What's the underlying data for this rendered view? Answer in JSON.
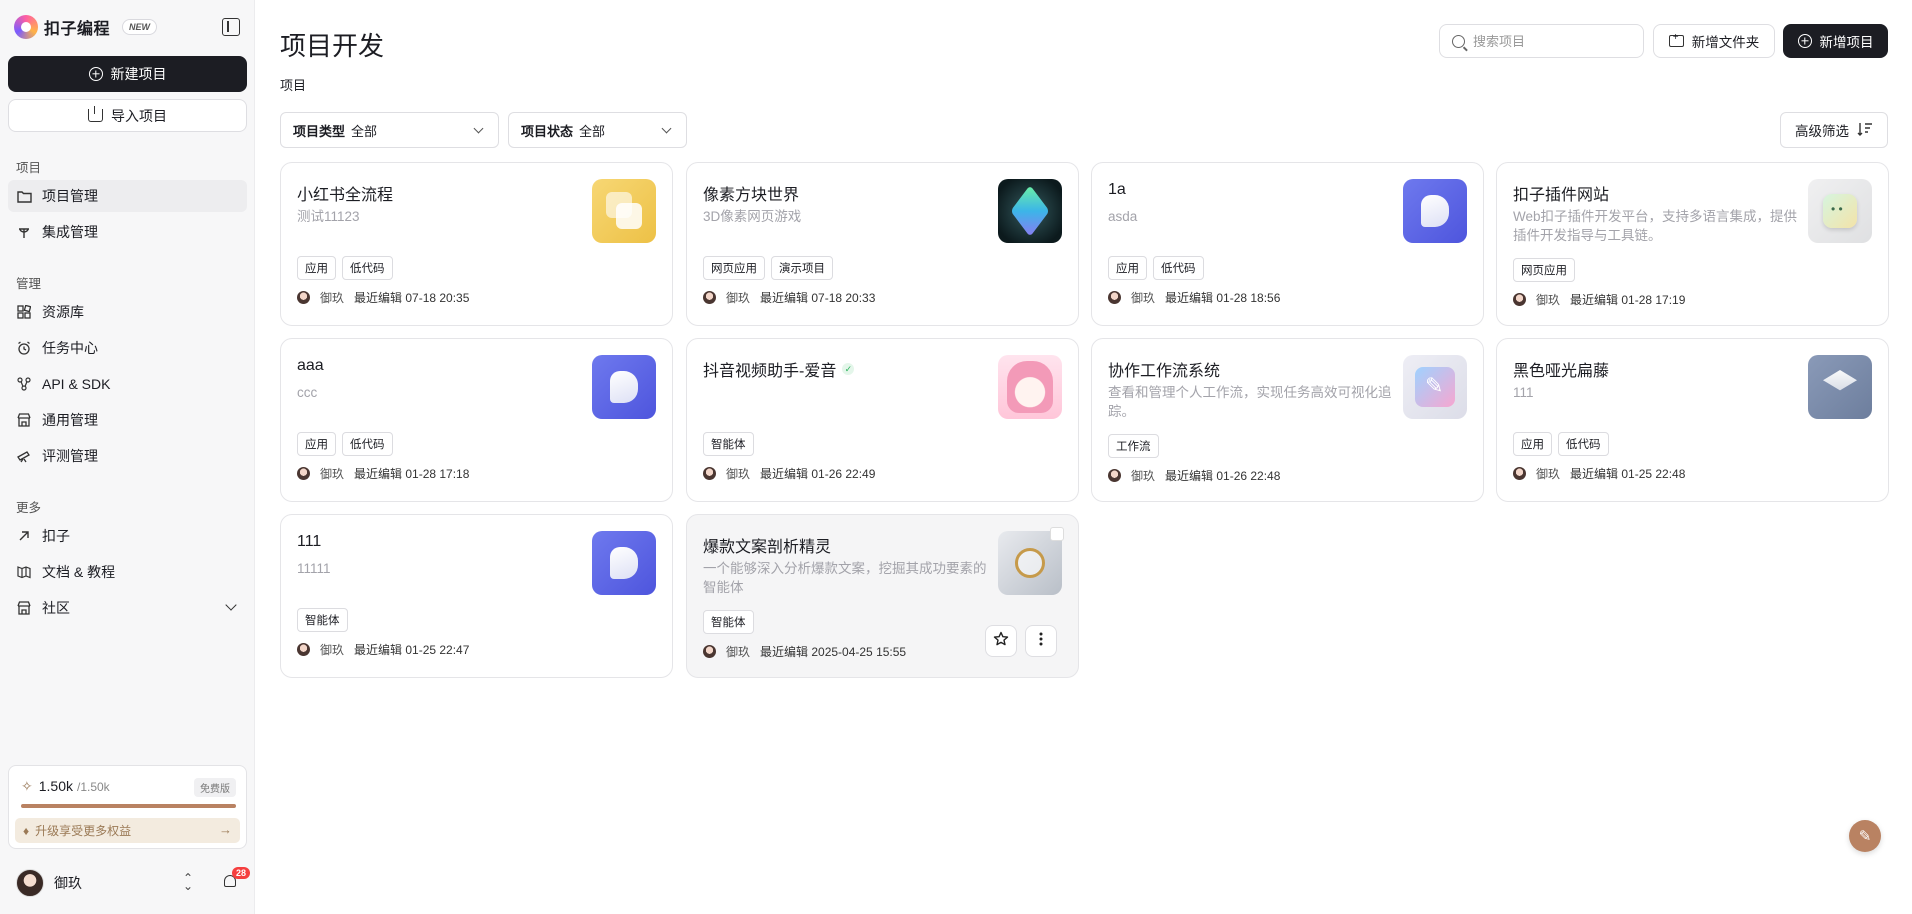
{
  "brand": {
    "name": "扣子编程",
    "badge": "NEW"
  },
  "sidebar": {
    "new_project": "新建项目",
    "import_project": "导入项目",
    "sections": {
      "project": "项目",
      "manage": "管理",
      "more": "更多"
    },
    "items": {
      "project_manage": "项目管理",
      "integration": "集成管理",
      "resources": "资源库",
      "tasks": "任务中心",
      "api_sdk": "API & SDK",
      "general": "通用管理",
      "evaluation": "评测管理",
      "kouzi": "扣子",
      "docs": "文档 & 教程",
      "community": "社区"
    },
    "quota": {
      "used": "1.50k",
      "max": "/1.50k",
      "tier": "免费版",
      "fill_percent": 100,
      "upgrade": "升级享受更多权益"
    },
    "user": {
      "name": "御玖",
      "notifications": "28"
    }
  },
  "header": {
    "title": "项目开发",
    "subtitle": "项目",
    "search_placeholder": "搜索项目",
    "new_folder": "新增文件夹",
    "new_project": "新增项目"
  },
  "filters": {
    "type_label": "项目类型",
    "type_value": "全部",
    "status_label": "项目状态",
    "status_value": "全部",
    "advanced": "高级筛选"
  },
  "projects": [
    {
      "title": "小红书全流程",
      "desc": "测试11123",
      "tags": [
        "应用",
        "低代码"
      ],
      "author": "御玖",
      "edited": "最近编辑 07-18 20:35",
      "thumb": "yellow-squares"
    },
    {
      "title": "像素方块世界",
      "desc": "3D像素网页游戏",
      "tags": [
        "网页应用",
        "演示项目"
      ],
      "author": "御玖",
      "edited": "最近编辑 07-18 20:33",
      "thumb": "pixel-cube"
    },
    {
      "title": "1a",
      "desc": "asda",
      "tags": [
        "应用",
        "低代码"
      ],
      "author": "御玖",
      "edited": "最近编辑 01-28 18:56",
      "thumb": "b-logo"
    },
    {
      "title": "扣子插件网站",
      "desc": "Web扣子插件开发平台，支持多语言集成，提供插件开发指导与工具链。",
      "tags": [
        "网页应用"
      ],
      "author": "御玖",
      "edited": "最近编辑 01-28 17:19",
      "thumb": "plugin"
    },
    {
      "title": "aaa",
      "desc": "ccc",
      "tags": [
        "应用",
        "低代码"
      ],
      "author": "御玖",
      "edited": "最近编辑 01-28 17:18",
      "thumb": "b-logo"
    },
    {
      "title": "抖音视频助手-爱音",
      "desc": "",
      "tags": [
        "智能体"
      ],
      "author": "御玖",
      "edited": "最近编辑 01-26 22:49",
      "thumb": "anime"
    },
    {
      "title": "协作工作流系统",
      "desc": "查看和管理个人工作流，实现任务高效可视化追踪。",
      "tags": [
        "工作流"
      ],
      "author": "御玖",
      "edited": "最近编辑 01-26 22:48",
      "thumb": "workflow"
    },
    {
      "title": "黑色哑光扁藤",
      "desc": "111",
      "tags": [
        "应用",
        "低代码"
      ],
      "author": "御玖",
      "edited": "最近编辑 01-25 22:48",
      "thumb": "layers"
    },
    {
      "title": "111",
      "desc": "11111",
      "tags": [
        "智能体"
      ],
      "author": "御玖",
      "edited": "最近编辑 01-25 22:47",
      "thumb": "b-logo"
    },
    {
      "title": "爆款文案剖析精灵",
      "desc": "一个能够深入分析爆款文案，挖掘其成功要素的智能体",
      "tags": [
        "智能体"
      ],
      "author": "御玖",
      "edited": "最近编辑 2025-04-25 15:55",
      "thumb": "paper"
    }
  ],
  "icons": {
    "favorite": "star-icon",
    "more": "more-vertical-icon",
    "feedback": "edit-note-icon"
  }
}
